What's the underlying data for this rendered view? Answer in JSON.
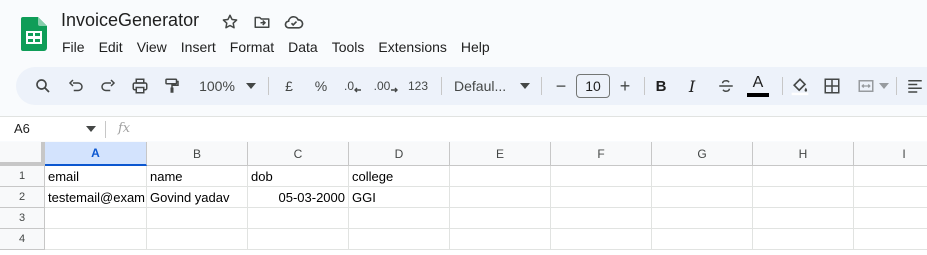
{
  "app": {
    "doc_title": "InvoiceGenerator",
    "title_icons": [
      "star-icon",
      "move-to-folder-icon",
      "cloud-status-icon"
    ]
  },
  "menu": [
    "File",
    "Edit",
    "View",
    "Insert",
    "Format",
    "Data",
    "Tools",
    "Extensions",
    "Help"
  ],
  "toolbar": {
    "zoom": "100%",
    "currency": "£",
    "percent": "%",
    "decrease_decimal": ".0",
    "increase_decimal": ".00",
    "number_format": "123",
    "font": "Defaul...",
    "font_size": "10",
    "minus": "−",
    "plus": "+",
    "bold": "B",
    "italic": "I",
    "text_color_letter": "A",
    "text_color": "#000000"
  },
  "formula_bar": {
    "name_box": "A6",
    "fx": "fx",
    "value": ""
  },
  "sheet": {
    "columns": [
      "A",
      "B",
      "C",
      "D",
      "E",
      "F",
      "G",
      "H",
      "I"
    ],
    "selected_column": "A",
    "rows": [
      "1",
      "2",
      "3",
      "4"
    ],
    "cells": [
      [
        "email",
        "name",
        "dob",
        "college",
        "",
        "",
        "",
        "",
        ""
      ],
      [
        "testemail@exam",
        "Govind yadav",
        "05-03-2000",
        "GGI",
        "",
        "",
        "",
        "",
        ""
      ],
      [
        "",
        "",
        "",
        "",
        "",
        "",
        "",
        "",
        ""
      ],
      [
        "",
        "",
        "",
        "",
        "",
        "",
        "",
        "",
        ""
      ]
    ]
  },
  "colors": {
    "brand_green": "#0f9d58",
    "selection_blue": "#0b57d0",
    "toolbar_bg": "#edf2fa"
  }
}
